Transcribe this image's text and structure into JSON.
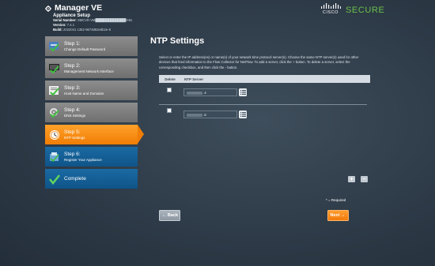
{
  "header": {
    "product_title": "Manager VE",
    "subtitle": "Appliance Setup",
    "serial_label": "Serial Number:",
    "serial_value": "SMCVE-VM█████████████fe81",
    "version_label": "Version:",
    "version_value": "7.4.1",
    "build_label": "Build:",
    "build_value": "2022041 1352-9674882e5b2e-8",
    "cisco_word": "CISCO",
    "secure_word": "SECURE"
  },
  "steps": [
    {
      "num": "Step 1:",
      "label": "Change Default Password",
      "state": "done",
      "icon": "password-icon"
    },
    {
      "num": "Step 2:",
      "label": "Management Network Interface",
      "state": "done",
      "icon": "network-interface-icon"
    },
    {
      "num": "Step 3:",
      "label": "Host Name and Domains",
      "state": "done",
      "icon": "host-name-icon"
    },
    {
      "num": "Step 4:",
      "label": "DNS Settings",
      "state": "done",
      "icon": "dns-gear-icon"
    },
    {
      "num": "Step 5:",
      "label": "NTP Settings",
      "state": "active",
      "icon": "clock-icon"
    },
    {
      "num": "Step 6:",
      "label": "Register Your Appliance",
      "state": "future",
      "icon": "register-icon"
    },
    {
      "num": "Complete",
      "label": "",
      "state": "future",
      "icon": "complete-check-icon"
    }
  ],
  "main": {
    "title": "NTP Settings",
    "description": "Select or enter the IP address(es) or name(s) of your network time protocol server(s). Choose the same NTP server(s) used for other devices that feed information to the Flow Collector for NetFlow. To add a server, click the + button. To delete a server, select the corresponding checkbox, and then click the - button.",
    "col_delete": "Delete",
    "col_ntp": "NTP Server",
    "rows": [
      {
        "value": ".4"
      },
      {
        "value": ".8"
      }
    ],
    "add_label": "+",
    "remove_label": "−",
    "required_note": "* = Required",
    "back_label": "Back",
    "next_label": "Next"
  },
  "colors": {
    "active_step": "#f07d05",
    "future_step": "#0f5488",
    "done_step": "#7a7a7a",
    "secure_green": "#6cc04a"
  }
}
